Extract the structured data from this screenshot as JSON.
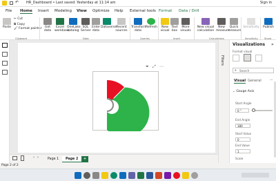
{
  "titlebar": {
    "title": "HR_Dashboard • Last saved: Yesterday at 11:14 am",
    "sign_in": "Sign in"
  },
  "menu": [
    "File",
    "Home",
    "Insert",
    "Modeling",
    "View",
    "Optimize",
    "Help",
    "External tools",
    "Format",
    "Data / Drill"
  ],
  "ribbon": {
    "clipboard": {
      "paste": "Paste",
      "cut": "Cut",
      "copy": "Copy",
      "format_painter": "Format painter",
      "group": "Clipboard"
    },
    "data": {
      "get_data": "Get data",
      "excel": "Excel workbook",
      "onelake": "OneLake catalog",
      "sql": "SQL Server",
      "enter": "Enter data",
      "dataverse": "Dataverse",
      "recent": "Recent sources",
      "group": "Data"
    },
    "queries": {
      "transform": "Transform data",
      "refresh": "Refresh",
      "group": "Queries"
    },
    "insert": {
      "new_visual": "New visual",
      "text_box": "Text box",
      "more_visuals": "More visuals",
      "group": "Insert"
    },
    "calculations": {
      "new_visual_calc": "New visual calculation",
      "new_measure": "New measure",
      "quick_measure": "Quick measure",
      "group": "Calculations"
    },
    "sensitivity": {
      "label": "Sensitivity",
      "group": "Sensitivity"
    },
    "share": {
      "publish": "Publish",
      "group": "Share"
    }
  },
  "gauge": {
    "min": 0,
    "max": 1,
    "red_fraction": 0.25
  },
  "filters_label": "Filters",
  "vispane": {
    "title": "Visualizations",
    "subtitle": "Format visual",
    "search_placeholder": "Search",
    "tab_visual": "Visual",
    "tab_general": "General",
    "section": "Gauge Axis",
    "start_angle_label": "Start Angle",
    "start_angle_value": "0 °",
    "end_angle_label": "End Angle",
    "end_angle_value": "180",
    "start_value_label": "Start Value",
    "start_value_value": "0",
    "end_value_label": "End Value",
    "end_value_value": "1",
    "scale_label": "Scale"
  },
  "pages": [
    "Page 1",
    "Page 2"
  ],
  "add_page": "+",
  "status": "Page 2 of 2",
  "colors": {
    "accent": "#217346",
    "red": "#e81123",
    "green": "#2db34a",
    "yellow": "#f2c811"
  }
}
